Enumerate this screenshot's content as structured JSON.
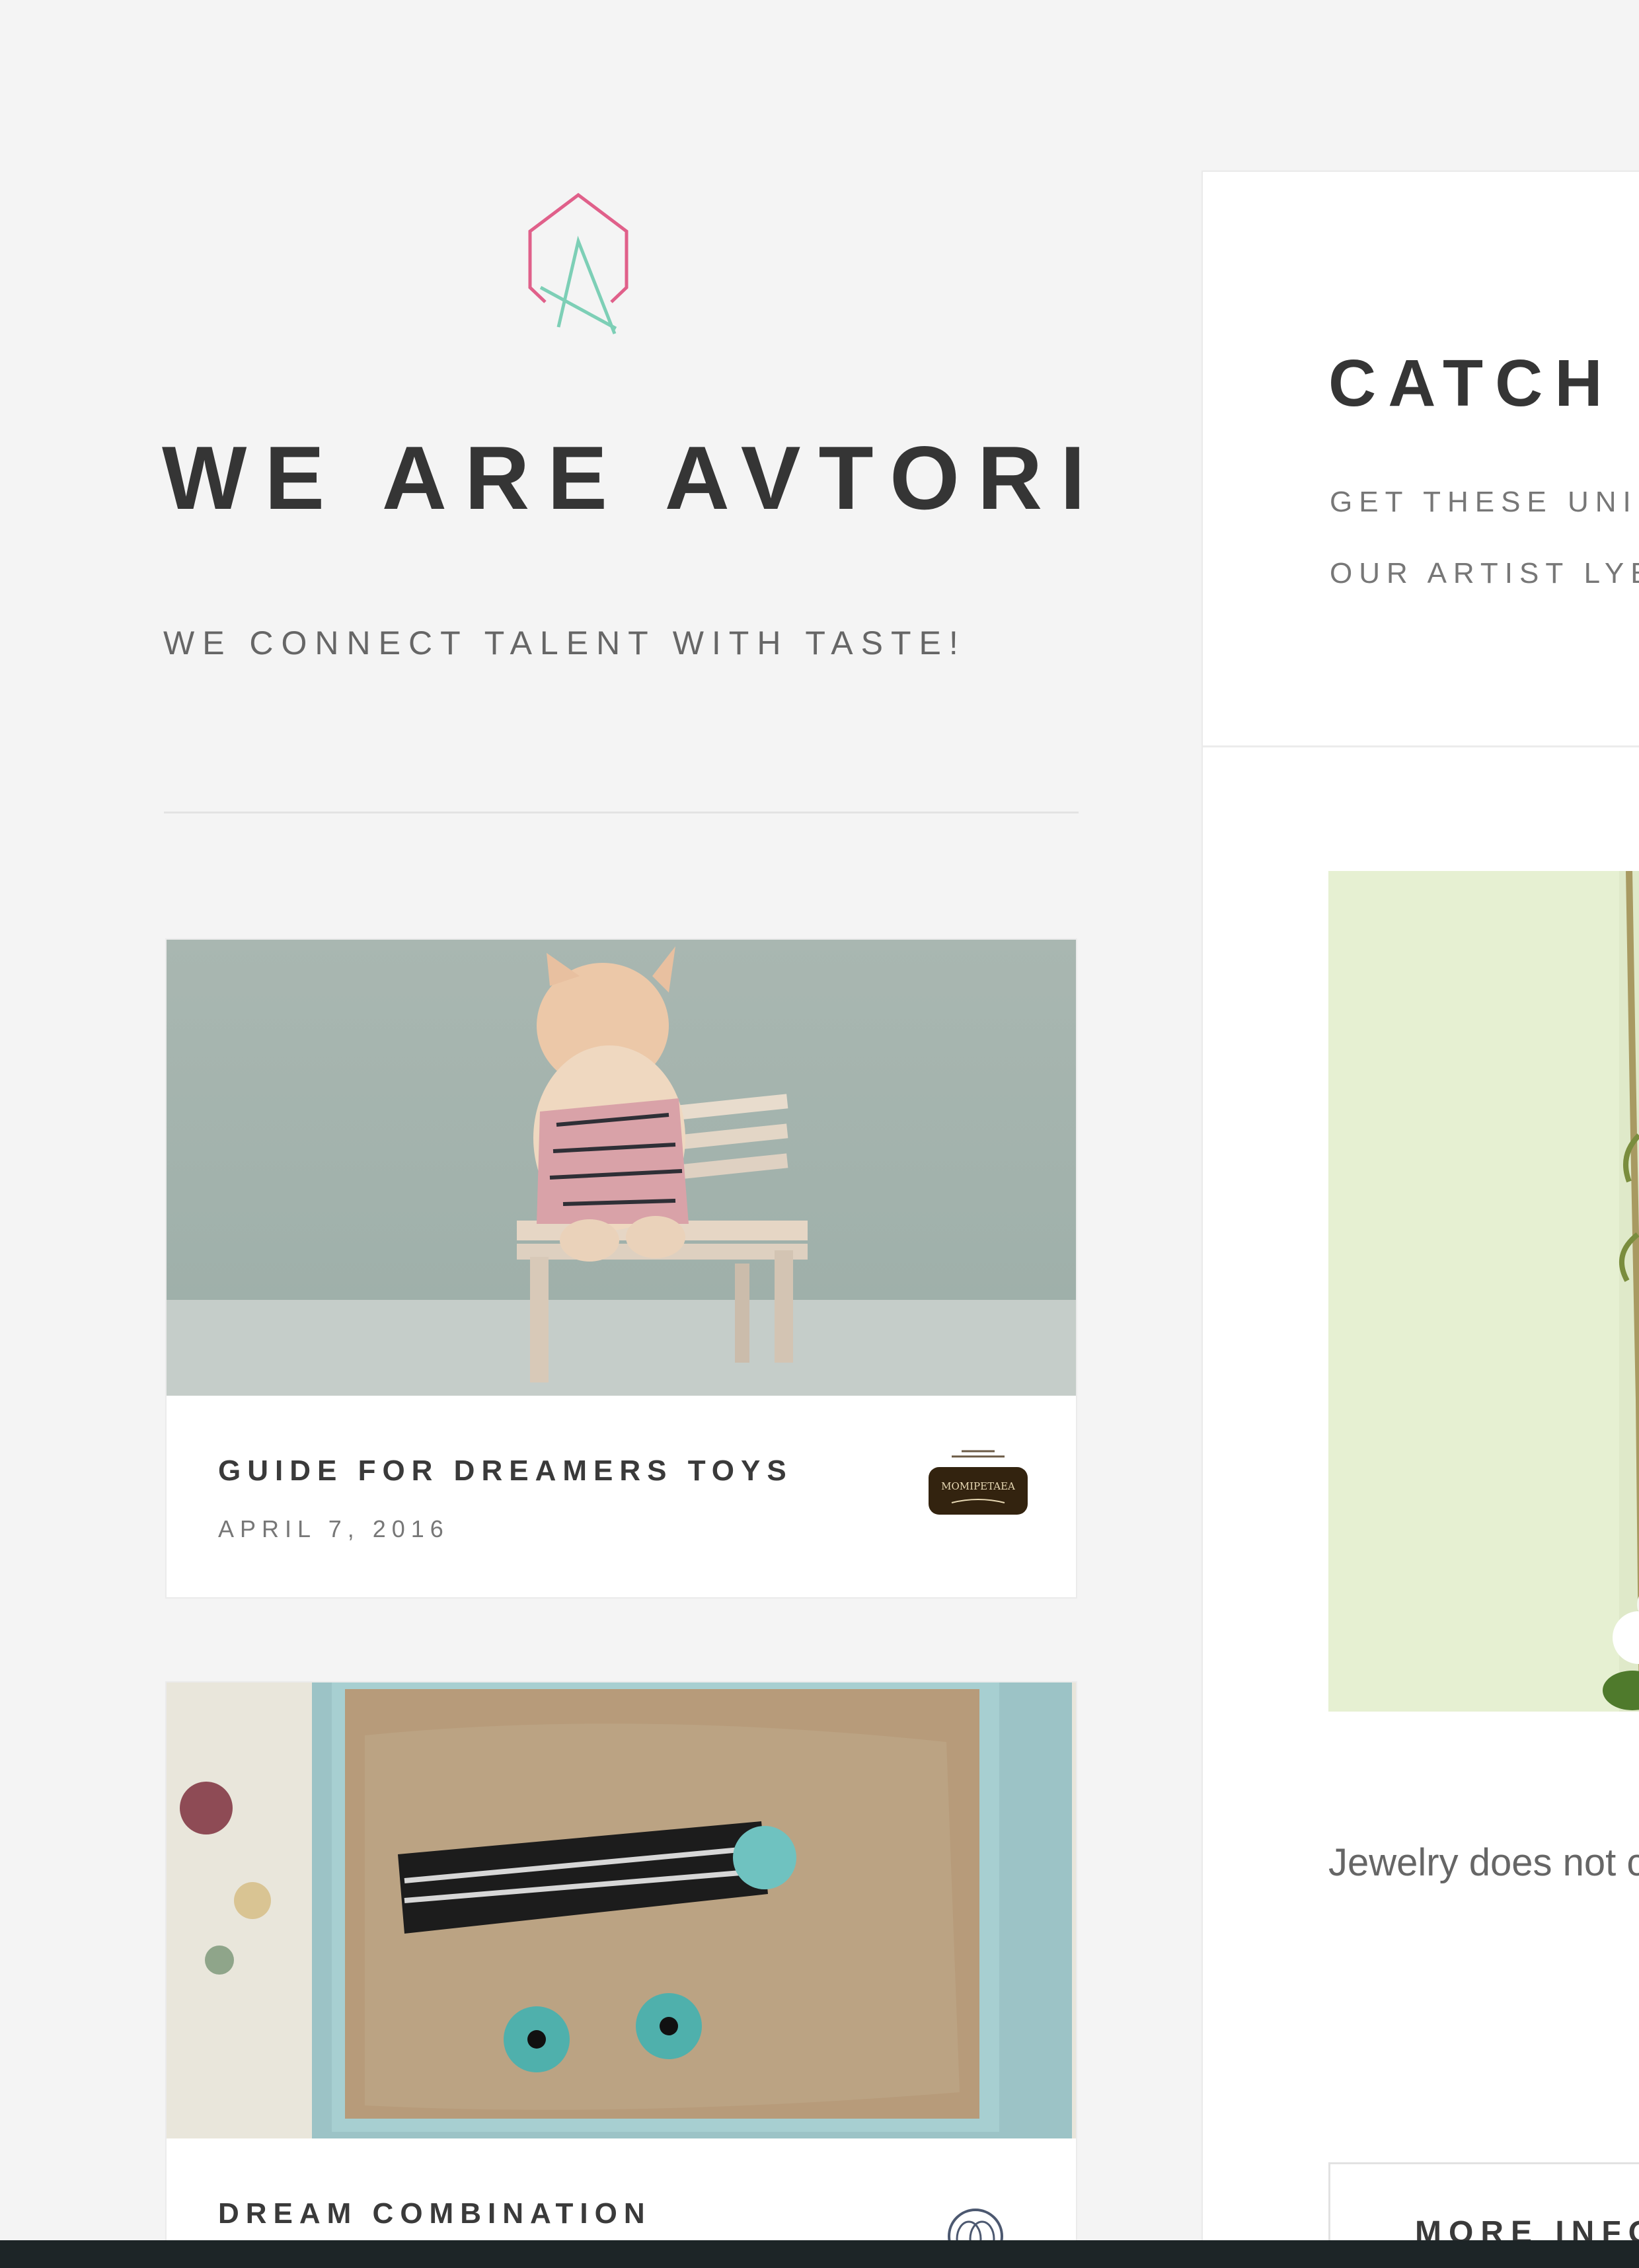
{
  "brand": {
    "logo_icon": "avtori-hexagon-a-logo-icon",
    "colors": {
      "logo_pink": "#e0608a",
      "logo_teal": "#7dcfb6",
      "background": "#f4f4f4",
      "text_dark": "#353535"
    }
  },
  "hero": {
    "title": "WE ARE AVTORI",
    "tagline": "WE CONNECT TALENT WITH TASTE!"
  },
  "posts": [
    {
      "title": "GUIDE FOR DREAMERS TOYS",
      "date": "APRIL 7, 2016",
      "image": "fox-doll-on-bench-photo",
      "artist_badge": "momipetaea-badge-icon",
      "artist_badge_text": "MOMIPETAEA"
    },
    {
      "title": "DREAM COMBINATION",
      "image": "jewelry-gift-box-photo",
      "artist_badge": "circular-logo-icon"
    }
  ],
  "feature": {
    "title": "CATCH",
    "subtitle_line1": "GET THESE UNIC",
    "subtitle_line2": "OUR ARTIST LYB",
    "image": "green-plant-photo",
    "description": "Jewelry does not c",
    "button_label": "MORE INFO"
  }
}
